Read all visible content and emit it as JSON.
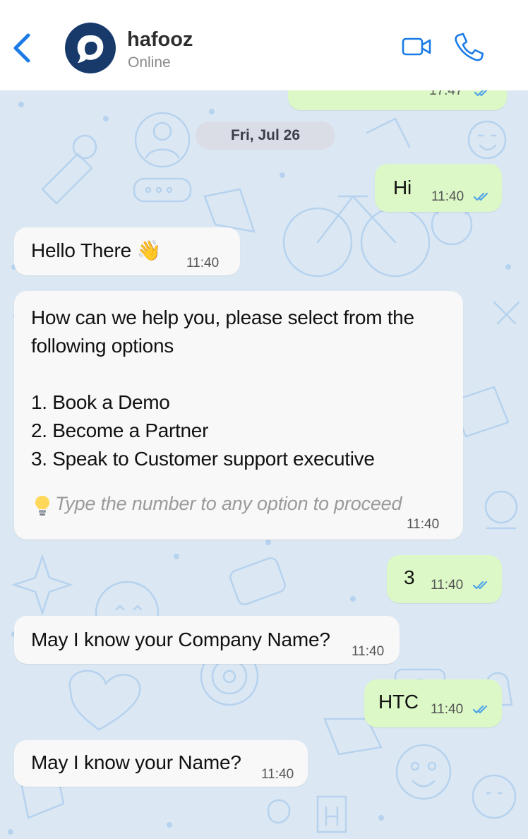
{
  "header": {
    "contact_name": "hafooz",
    "status": "Online"
  },
  "chat": {
    "partial_top_time": "17:47",
    "date_separator": "Fri, Jul 26",
    "messages": [
      {
        "direction": "outgoing",
        "text": "Hi",
        "time": "11:40",
        "read": true
      },
      {
        "direction": "incoming",
        "text": "Hello There 👋",
        "time": "11:40"
      },
      {
        "direction": "incoming",
        "lines": [
          "How can we help you, please select from the",
          "following options",
          "1. Book a Demo",
          "2. Become a Partner",
          "3. Speak to Customer support executive"
        ],
        "hint": "Type the number to any option to proceed",
        "time": "11:40"
      },
      {
        "direction": "outgoing",
        "text": "3",
        "time": "11:40",
        "read": true
      },
      {
        "direction": "incoming",
        "text": "May I know your Company Name?",
        "time": "11:40"
      },
      {
        "direction": "outgoing",
        "text": "HTC",
        "time": "11:40",
        "read": true
      },
      {
        "direction": "incoming",
        "text": "May I know your Name?",
        "time": "11:40"
      }
    ]
  },
  "colors": {
    "outgoing_bubble": "#dcf8c6",
    "incoming_bubble": "#f8f8f8",
    "accent_blue": "#1a7be6",
    "read_tick": "#4fa3e8",
    "wallpaper": "#dbe8f3",
    "avatar_bg": "#173a6b"
  },
  "icons": {
    "back": "chevron-left-icon",
    "video": "video-camera-icon",
    "call": "phone-icon",
    "hint": "lightbulb-icon"
  }
}
